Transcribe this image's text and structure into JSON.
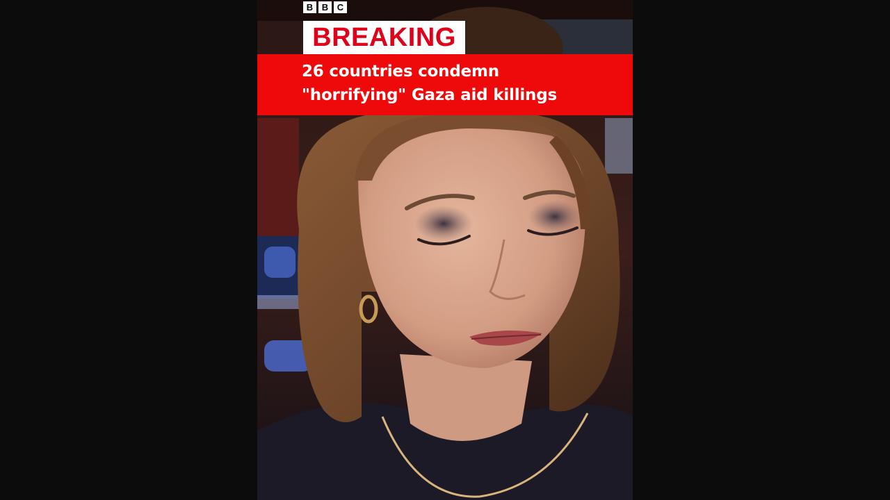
{
  "brand": {
    "logo_letters": [
      "B",
      "B",
      "C"
    ]
  },
  "banner": {
    "label": "BREAKING",
    "headline_line1": "26 countries condemn",
    "headline_line2": "\"horrifying\" Gaza aid killings"
  },
  "colors": {
    "banner_red": "#ee0a0a",
    "breaking_text_red": "#e1001a",
    "letterbox": "#0c0c0c"
  }
}
